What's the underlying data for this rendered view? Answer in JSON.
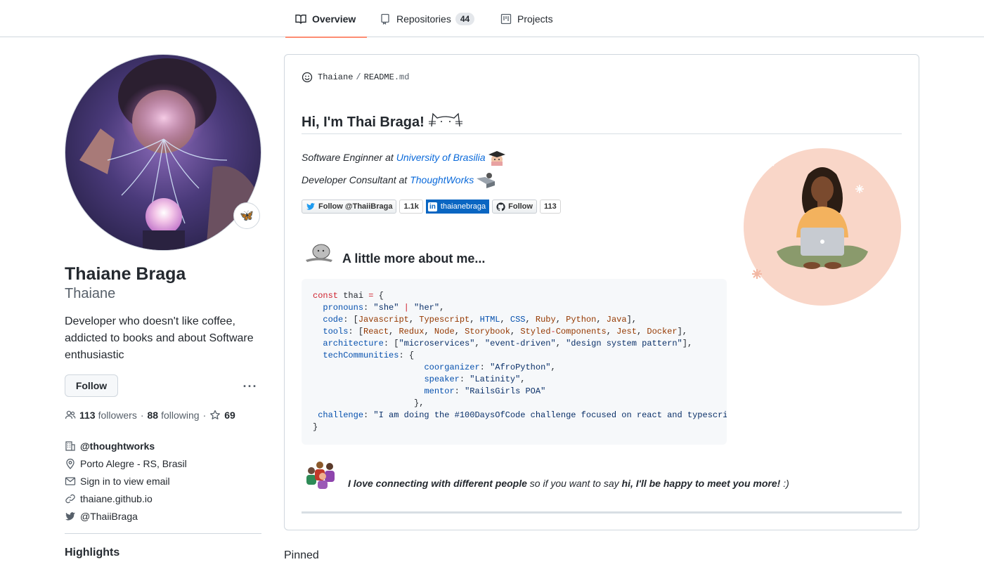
{
  "tabs": [
    {
      "label": "Overview",
      "icon": "book-icon"
    },
    {
      "label": "Repositories",
      "icon": "repo-icon",
      "count": "44"
    },
    {
      "label": "Projects",
      "icon": "project-icon"
    }
  ],
  "profile": {
    "full_name": "Thaiane Braga",
    "username": "Thaiane",
    "bio": "Developer who doesn't like coffee, addicted to books and about Software enthusiastic",
    "follow_label": "Follow",
    "more_label": "···",
    "followers_count": "113",
    "followers_label": "followers",
    "following_count": "88",
    "following_label": "following",
    "stars_count": "69",
    "organization": "@thoughtworks",
    "location": "Porto Alegre - RS, Brasil",
    "email": "Sign in to view email",
    "website": "thaiane.github.io",
    "twitter": "@ThaiiBraga",
    "highlights_heading": "Highlights",
    "status_emoji": "🦋"
  },
  "readme": {
    "owner": "Thaiane",
    "separator": "/",
    "file": "README",
    "ext": ".md",
    "title": "Hi, I'm Thai Braga!",
    "line1_prefix": "Software Enginner at",
    "line1_link": "University of Brasilia",
    "line2_prefix": "Developer Consultant at",
    "line2_link": "ThoughtWorks",
    "badges": {
      "twitter_label": "Follow @ThaiiBraga",
      "twitter_count": "1.1k",
      "linkedin_label": "thaianebraga",
      "github_label": "Follow",
      "github_count": "113"
    },
    "about_heading": "A little more about me...",
    "connect_bold1": "I love connecting with different people",
    "connect_mid": "so if you want to say",
    "connect_bold2": "hi, I'll be happy to meet you more!",
    "connect_end": ":)"
  },
  "pinned_label": "Pinned",
  "colors": {
    "accent_tab": "#fd8c73",
    "link": "#0969da",
    "linkedin": "#0a66c2"
  }
}
